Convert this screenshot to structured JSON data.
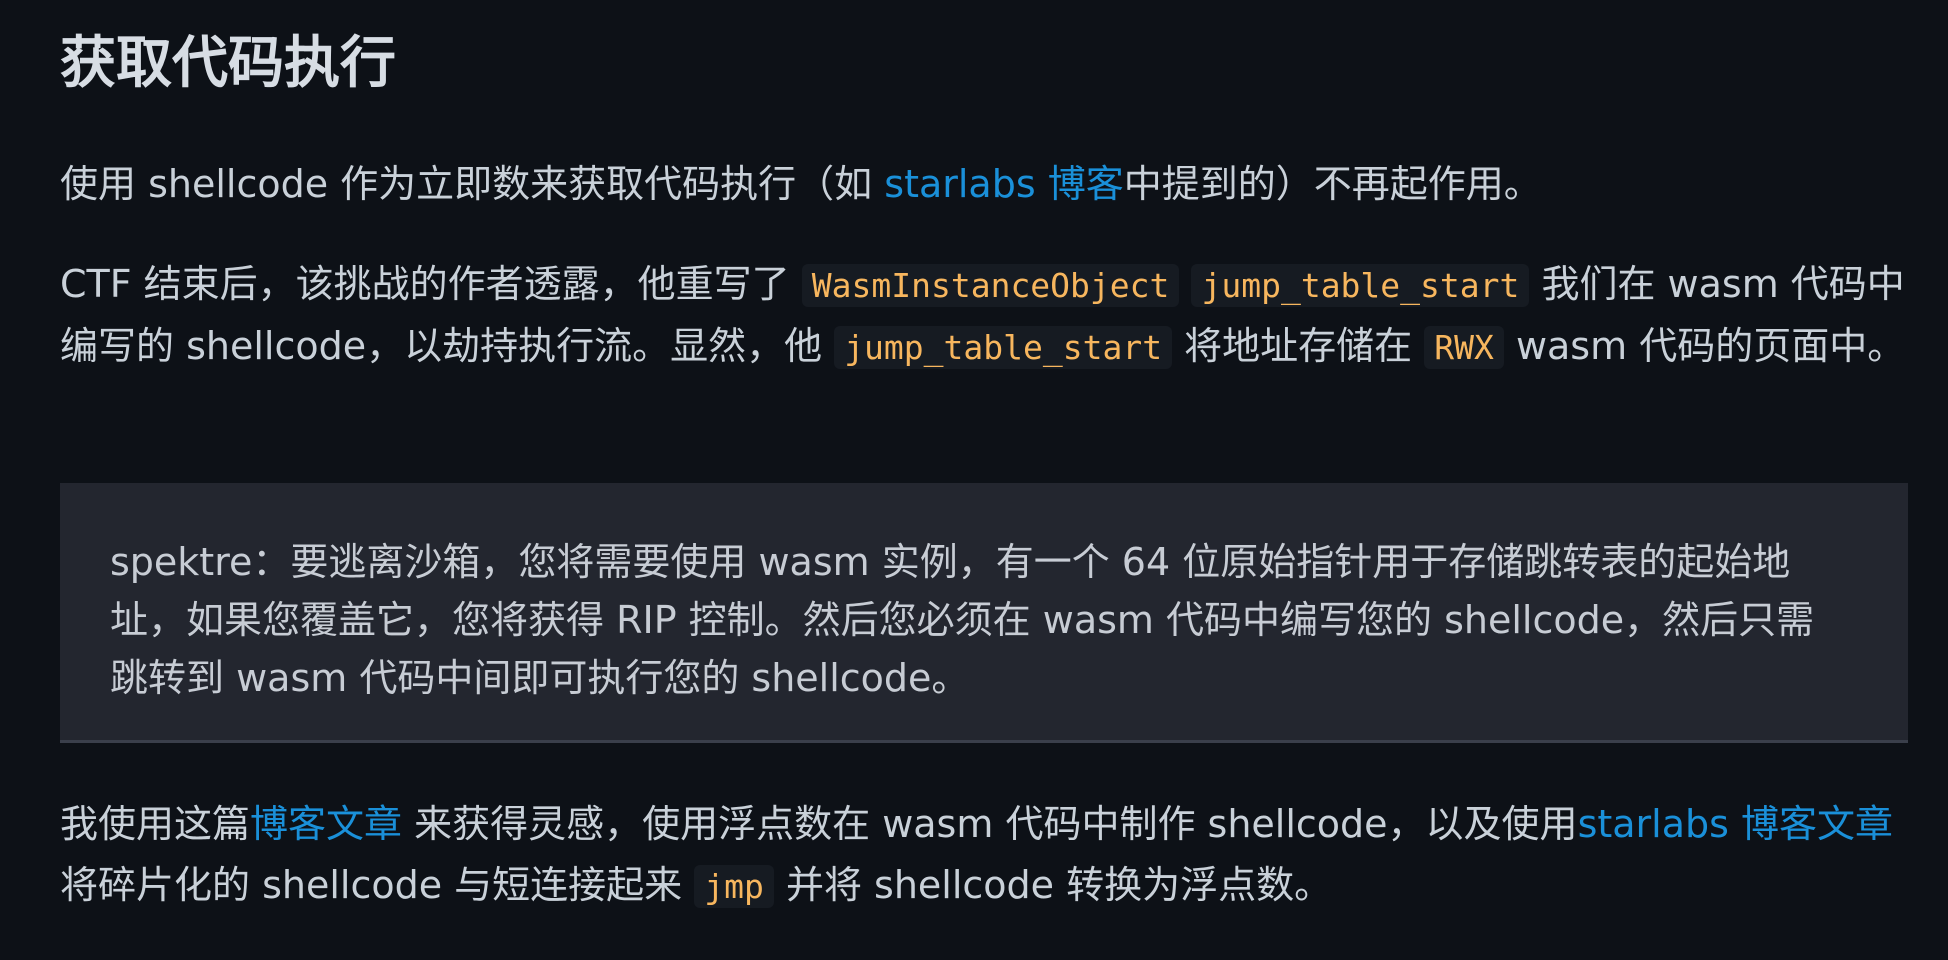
{
  "heading": "获取代码执行",
  "para1": {
    "before_link": "使用 shellcode 作为立即数来获取代码执行（如 ",
    "link": "starlabs 博客",
    "after_link": "中提到的）不再起作用。"
  },
  "para2": {
    "t1": "CTF 结束后，该挑战的作者透露，他重写了 ",
    "code1": "WasmInstanceObject",
    "code2": "jump_table_start",
    "t2": " 我们在 wasm 代码中编写的 shellcode，以劫持执行流。显然，他 ",
    "code3": "jump_table_start",
    "t3": " 将地址存储在 ",
    "code4": "RWX",
    "t4": " wasm 代码的页面中。"
  },
  "quote": {
    "text": "spektre：要逃离沙箱，您将需要使用 wasm 实例，有一个 64 位原始指针用于存储跳转表的起始地址，如果您覆盖它，您将获得 RIP 控制。然后您必须在 wasm 代码中编写您的 shellcode，然后只需跳转到 wasm 代码中间即可执行您的 shellcode。"
  },
  "para3": {
    "t1": "我使用这篇",
    "link1": "博客文章",
    "t2": " 来获得灵感，使用浮点数在 wasm 代码中制作 shellcode，以及使用",
    "link2": "starlabs 博客文章",
    "t3": " 将碎片化的 shellcode 与短连接起来 ",
    "code1": "jmp",
    "t4": " 并将 shellcode 转换为浮点数。"
  },
  "colors": {
    "background": "#0d1117",
    "text": "#c9d1d9",
    "link": "#1a90d9",
    "code": "#f7b65e",
    "quote_bg": "#23262f"
  }
}
